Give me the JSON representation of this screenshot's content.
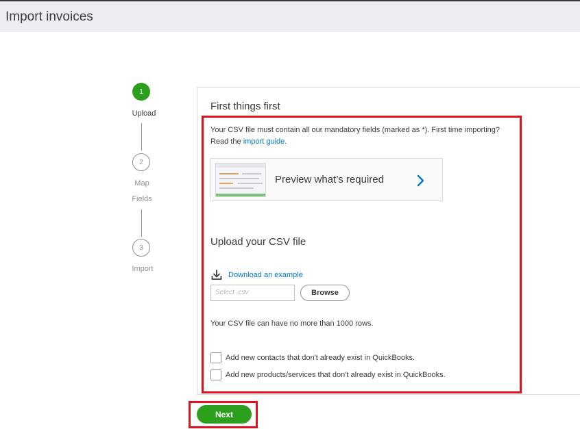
{
  "header": {
    "title": "Import invoices"
  },
  "stepper": {
    "steps": [
      {
        "number": "1",
        "label": "Upload",
        "label2": ""
      },
      {
        "number": "2",
        "label": "Map",
        "label2": "Fields"
      },
      {
        "number": "3",
        "label": "Import",
        "label2": ""
      }
    ],
    "active_step": 1
  },
  "card": {
    "title": "First things first",
    "intro_text": "Your CSV file must contain all our mandatory fields (marked as *). First time importing? Read the ",
    "intro_link": "import guide",
    "intro_end": ".",
    "preview_label": "Preview what’s required",
    "upload_title": "Upload your CSV file",
    "download_link": "Download an example",
    "file_placeholder": "Select .csv",
    "browse_label": "Browse",
    "rows_note": "Your CSV file can have no more than 1000 rows.",
    "checkboxes": [
      {
        "label": "Add new contacts that don't already exist in QuickBooks.",
        "checked": false
      },
      {
        "label": "Add new products/services that don't already exist in QuickBooks.",
        "checked": false
      }
    ]
  },
  "footer": {
    "next_label": "Next"
  },
  "colors": {
    "accent": "#2ca01c",
    "link": "#0077c5",
    "highlight": "#e0111b",
    "header_bg": "#eceef1"
  }
}
